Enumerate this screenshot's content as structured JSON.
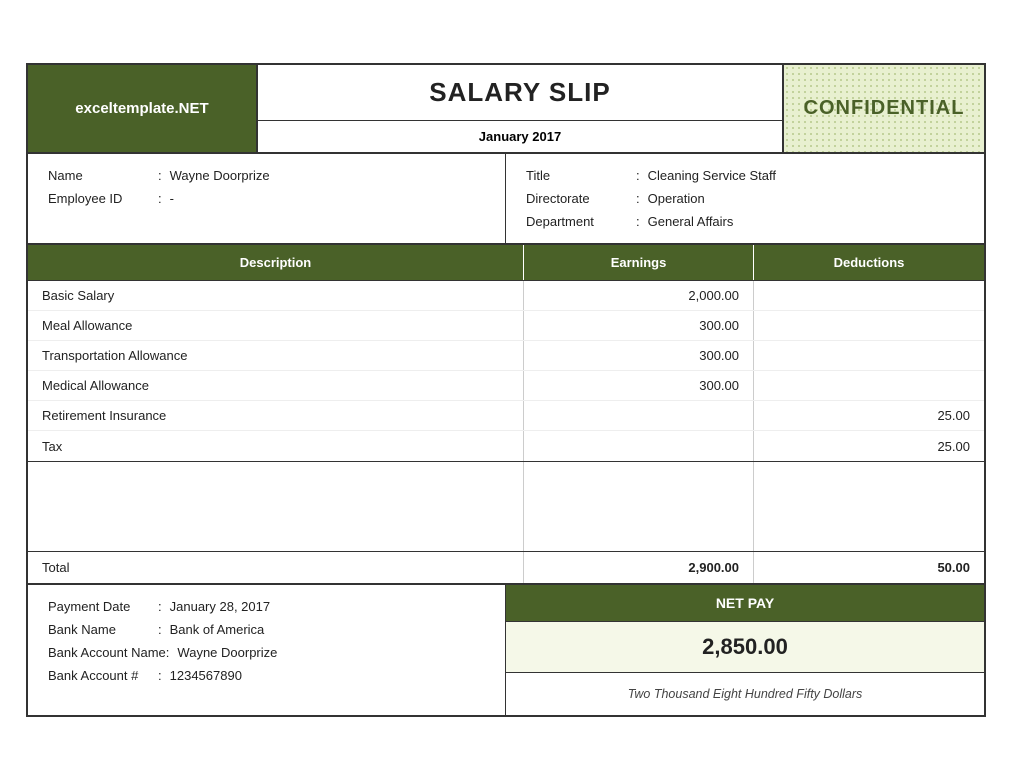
{
  "header": {
    "logo": "exceltemplate.NET",
    "title": "SALARY SLIP",
    "date": "January 2017",
    "confidential": "CONFIDENTIAL"
  },
  "employee": {
    "left": {
      "name_label": "Name",
      "name_value": "Wayne Doorprize",
      "id_label": "Employee ID",
      "id_value": "-"
    },
    "right": {
      "title_label": "Title",
      "title_value": "Cleaning Service Staff",
      "directorate_label": "Directorate",
      "directorate_value": "Operation",
      "department_label": "Department",
      "department_value": "General Affairs"
    }
  },
  "table": {
    "headers": {
      "description": "Description",
      "earnings": "Earnings",
      "deductions": "Deductions"
    },
    "rows": [
      {
        "description": "Basic Salary",
        "earnings": "2,000.00",
        "deductions": ""
      },
      {
        "description": "Meal Allowance",
        "earnings": "300.00",
        "deductions": ""
      },
      {
        "description": "Transportation Allowance",
        "earnings": "300.00",
        "deductions": ""
      },
      {
        "description": "Medical Allowance",
        "earnings": "300.00",
        "deductions": ""
      },
      {
        "description": "Retirement Insurance",
        "earnings": "",
        "deductions": "25.00"
      },
      {
        "description": "Tax",
        "earnings": "",
        "deductions": "25.00"
      }
    ],
    "total": {
      "label": "Total",
      "earnings": "2,900.00",
      "deductions": "50.00"
    }
  },
  "footer": {
    "payment_date_label": "Payment Date",
    "payment_date_value": "January 28, 2017",
    "bank_name_label": "Bank Name",
    "bank_name_value": "Bank of America",
    "bank_account_name_label": "Bank Account Name",
    "bank_account_name_value": "Wayne Doorprize",
    "bank_account_num_label": "Bank Account #",
    "bank_account_num_value": "1234567890",
    "net_pay_label": "NET PAY",
    "net_pay_value": "2,850.00",
    "net_pay_words": "Two Thousand Eight Hundred Fifty Dollars"
  }
}
